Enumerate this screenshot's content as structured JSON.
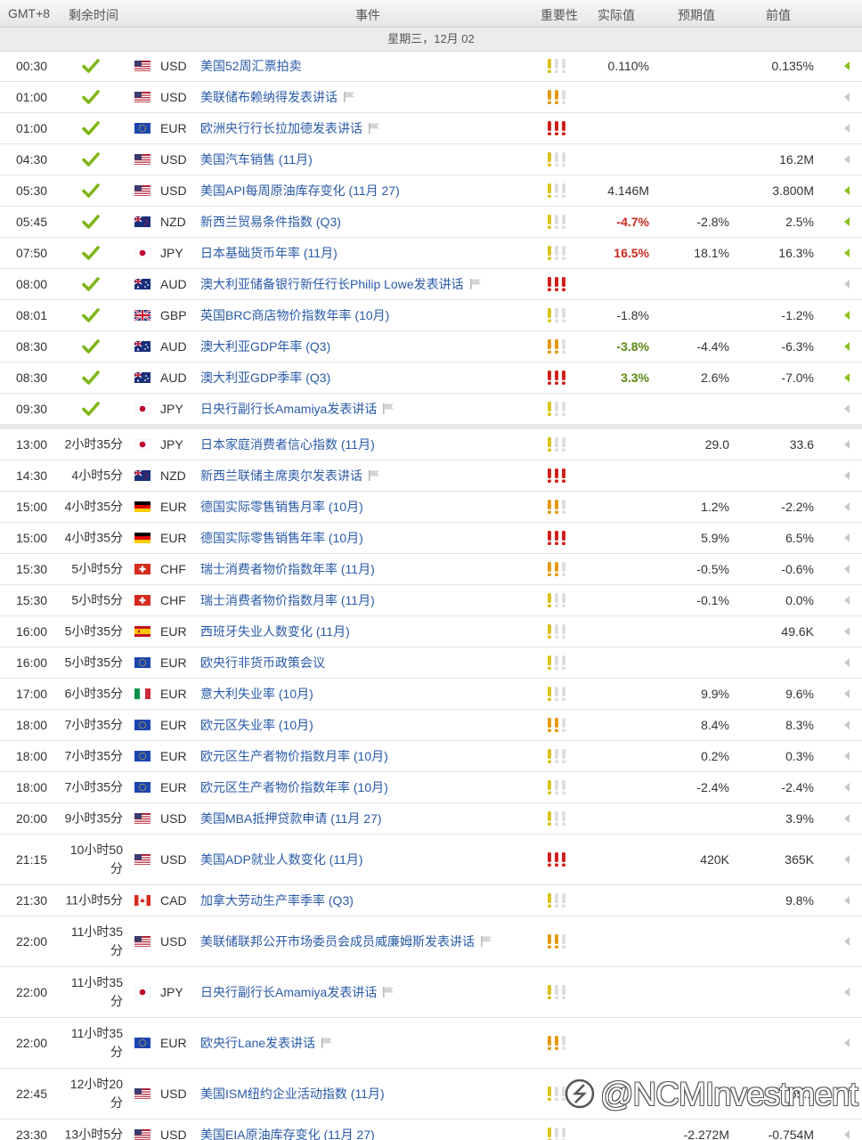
{
  "header": {
    "timezone": "GMT+8",
    "remaining": "剩余时间",
    "event": "事件",
    "importance": "重要性",
    "actual": "实际值",
    "forecast": "预期值",
    "previous": "前值"
  },
  "day_header": "星期三，12月 02",
  "colors": {
    "link": "#2a5aa8",
    "red": "#cc2a1e",
    "green": "#5b8a12",
    "check": "#7fb518",
    "imp_on_1": "#d9c21a",
    "imp_on_2": "#e69a12",
    "imp_on_3": "#d0201a",
    "imp_off": "#dedede"
  },
  "rows": [
    {
      "time": "00:30",
      "remaining": "",
      "done": true,
      "flag": "us",
      "currency": "USD",
      "event": "美国52周汇票拍卖",
      "speech": false,
      "importance": 1,
      "actual": "0.110%",
      "actual_style": "",
      "forecast": "",
      "previous": "0.135%",
      "arrow": "on"
    },
    {
      "time": "01:00",
      "remaining": "",
      "done": true,
      "flag": "us",
      "currency": "USD",
      "event": "美联储布赖纳得发表讲话",
      "speech": true,
      "importance": 2,
      "actual": "",
      "actual_style": "",
      "forecast": "",
      "previous": "",
      "arrow": ""
    },
    {
      "time": "01:00",
      "remaining": "",
      "done": true,
      "flag": "eu",
      "currency": "EUR",
      "event": "欧洲央行行长拉加德发表讲话",
      "speech": true,
      "importance": 3,
      "actual": "",
      "actual_style": "",
      "forecast": "",
      "previous": "",
      "arrow": ""
    },
    {
      "time": "04:30",
      "remaining": "",
      "done": true,
      "flag": "us",
      "currency": "USD",
      "event": "美国汽车销售 (11月)",
      "speech": false,
      "importance": 1,
      "actual": "",
      "actual_style": "",
      "forecast": "",
      "previous": "16.2M",
      "arrow": ""
    },
    {
      "time": "05:30",
      "remaining": "",
      "done": true,
      "flag": "us",
      "currency": "USD",
      "event": "美国API每周原油库存变化 (11月 27)",
      "speech": false,
      "importance": 1,
      "actual": "4.146M",
      "actual_style": "",
      "forecast": "",
      "previous": "3.800M",
      "arrow": "on"
    },
    {
      "time": "05:45",
      "remaining": "",
      "done": true,
      "flag": "nz",
      "currency": "NZD",
      "event": "新西兰贸易条件指数 (Q3)",
      "speech": false,
      "importance": 1,
      "actual": "-4.7%",
      "actual_style": "red",
      "forecast": "-2.8%",
      "previous": "2.5%",
      "arrow": "on"
    },
    {
      "time": "07:50",
      "remaining": "",
      "done": true,
      "flag": "jp",
      "currency": "JPY",
      "event": "日本基础货币年率 (11月)",
      "speech": false,
      "importance": 1,
      "actual": "16.5%",
      "actual_style": "red",
      "forecast": "18.1%",
      "previous": "16.3%",
      "arrow": "on"
    },
    {
      "time": "08:00",
      "remaining": "",
      "done": true,
      "flag": "au",
      "currency": "AUD",
      "event": "澳大利亚储备银行新任行长Philip Lowe发表讲话",
      "speech": true,
      "importance": 3,
      "actual": "",
      "actual_style": "",
      "forecast": "",
      "previous": "",
      "arrow": ""
    },
    {
      "time": "08:01",
      "remaining": "",
      "done": true,
      "flag": "gb",
      "currency": "GBP",
      "event": "英国BRC商店物价指数年率 (10月)",
      "speech": false,
      "importance": 1,
      "actual": "-1.8%",
      "actual_style": "",
      "forecast": "",
      "previous": "-1.2%",
      "arrow": "on"
    },
    {
      "time": "08:30",
      "remaining": "",
      "done": true,
      "flag": "au",
      "currency": "AUD",
      "event": "澳大利亚GDP年率 (Q3)",
      "speech": false,
      "importance": 2,
      "actual": "-3.8%",
      "actual_style": "green",
      "forecast": "-4.4%",
      "previous": "-6.3%",
      "arrow": "on"
    },
    {
      "time": "08:30",
      "remaining": "",
      "done": true,
      "flag": "au",
      "currency": "AUD",
      "event": "澳大利亚GDP季率 (Q3)",
      "speech": false,
      "importance": 3,
      "actual": "3.3%",
      "actual_style": "green",
      "forecast": "2.6%",
      "previous": "-7.0%",
      "arrow": "on"
    },
    {
      "time": "09:30",
      "remaining": "",
      "done": true,
      "flag": "jp",
      "currency": "JPY",
      "event": "日央行副行长Amamiya发表讲话",
      "speech": true,
      "importance": 1,
      "actual": "",
      "actual_style": "",
      "forecast": "",
      "previous": "",
      "arrow": "",
      "sep": true
    },
    {
      "time": "13:00",
      "remaining": "2小时35分",
      "done": false,
      "flag": "jp",
      "currency": "JPY",
      "event": "日本家庭消费者信心指数 (11月)",
      "speech": false,
      "importance": 1,
      "actual": "",
      "actual_style": "",
      "forecast": "29.0",
      "previous": "33.6",
      "arrow": ""
    },
    {
      "time": "14:30",
      "remaining": "4小时5分",
      "done": false,
      "flag": "nz",
      "currency": "NZD",
      "event": "新西兰联储主席奥尔发表讲话",
      "speech": true,
      "importance": 3,
      "actual": "",
      "actual_style": "",
      "forecast": "",
      "previous": "",
      "arrow": ""
    },
    {
      "time": "15:00",
      "remaining": "4小时35分",
      "done": false,
      "flag": "de",
      "currency": "EUR",
      "event": "德国实际零售销售月率 (10月)",
      "speech": false,
      "importance": 2,
      "actual": "",
      "actual_style": "",
      "forecast": "1.2%",
      "previous": "-2.2%",
      "arrow": ""
    },
    {
      "time": "15:00",
      "remaining": "4小时35分",
      "done": false,
      "flag": "de",
      "currency": "EUR",
      "event": "德国实际零售销售年率 (10月)",
      "speech": false,
      "importance": 3,
      "actual": "",
      "actual_style": "",
      "forecast": "5.9%",
      "previous": "6.5%",
      "arrow": ""
    },
    {
      "time": "15:30",
      "remaining": "5小时5分",
      "done": false,
      "flag": "ch",
      "currency": "CHF",
      "event": "瑞士消费者物价指数年率 (11月)",
      "speech": false,
      "importance": 2,
      "actual": "",
      "actual_style": "",
      "forecast": "-0.5%",
      "previous": "-0.6%",
      "arrow": ""
    },
    {
      "time": "15:30",
      "remaining": "5小时5分",
      "done": false,
      "flag": "ch",
      "currency": "CHF",
      "event": "瑞士消费者物价指数月率 (11月)",
      "speech": false,
      "importance": 1,
      "actual": "",
      "actual_style": "",
      "forecast": "-0.1%",
      "previous": "0.0%",
      "arrow": ""
    },
    {
      "time": "16:00",
      "remaining": "5小时35分",
      "done": false,
      "flag": "es",
      "currency": "EUR",
      "event": "西班牙失业人数变化 (11月)",
      "speech": false,
      "importance": 1,
      "actual": "",
      "actual_style": "",
      "forecast": "",
      "previous": "49.6K",
      "arrow": ""
    },
    {
      "time": "16:00",
      "remaining": "5小时35分",
      "done": false,
      "flag": "eu",
      "currency": "EUR",
      "event": "欧央行非货币政策会议",
      "speech": false,
      "importance": 1,
      "actual": "",
      "actual_style": "",
      "forecast": "",
      "previous": "",
      "arrow": ""
    },
    {
      "time": "17:00",
      "remaining": "6小时35分",
      "done": false,
      "flag": "it",
      "currency": "EUR",
      "event": "意大利失业率 (10月)",
      "speech": false,
      "importance": 1,
      "actual": "",
      "actual_style": "",
      "forecast": "9.9%",
      "previous": "9.6%",
      "arrow": ""
    },
    {
      "time": "18:00",
      "remaining": "7小时35分",
      "done": false,
      "flag": "eu",
      "currency": "EUR",
      "event": "欧元区失业率 (10月)",
      "speech": false,
      "importance": 2,
      "actual": "",
      "actual_style": "",
      "forecast": "8.4%",
      "previous": "8.3%",
      "arrow": ""
    },
    {
      "time": "18:00",
      "remaining": "7小时35分",
      "done": false,
      "flag": "eu",
      "currency": "EUR",
      "event": "欧元区生产者物价指数月率 (10月)",
      "speech": false,
      "importance": 1,
      "actual": "",
      "actual_style": "",
      "forecast": "0.2%",
      "previous": "0.3%",
      "arrow": ""
    },
    {
      "time": "18:00",
      "remaining": "7小时35分",
      "done": false,
      "flag": "eu",
      "currency": "EUR",
      "event": "欧元区生产者物价指数年率 (10月)",
      "speech": false,
      "importance": 1,
      "actual": "",
      "actual_style": "",
      "forecast": "-2.4%",
      "previous": "-2.4%",
      "arrow": ""
    },
    {
      "time": "20:00",
      "remaining": "9小时35分",
      "done": false,
      "flag": "us",
      "currency": "USD",
      "event": "美国MBA抵押贷款申请 (11月 27)",
      "speech": false,
      "importance": 1,
      "actual": "",
      "actual_style": "",
      "forecast": "",
      "previous": "3.9%",
      "arrow": ""
    },
    {
      "time": "21:15",
      "remaining": "10小时50分",
      "done": false,
      "flag": "us",
      "currency": "USD",
      "event": "美国ADP就业人数变化 (11月)",
      "speech": false,
      "importance": 3,
      "actual": "",
      "actual_style": "",
      "forecast": "420K",
      "previous": "365K",
      "arrow": "",
      "tall": true
    },
    {
      "time": "21:30",
      "remaining": "11小时5分",
      "done": false,
      "flag": "ca",
      "currency": "CAD",
      "event": "加拿大劳动生产率季率 (Q3)",
      "speech": false,
      "importance": 1,
      "actual": "",
      "actual_style": "",
      "forecast": "",
      "previous": "9.8%",
      "arrow": ""
    },
    {
      "time": "22:00",
      "remaining": "11小时35分",
      "done": false,
      "flag": "us",
      "currency": "USD",
      "event": "美联储联邦公开市场委员会成员威廉姆斯发表讲话",
      "speech": true,
      "importance": 2,
      "actual": "",
      "actual_style": "",
      "forecast": "",
      "previous": "",
      "arrow": "",
      "tall": true
    },
    {
      "time": "22:00",
      "remaining": "11小时35分",
      "done": false,
      "flag": "jp",
      "currency": "JPY",
      "event": "日央行副行长Amamiya发表讲话",
      "speech": true,
      "importance": 1,
      "actual": "",
      "actual_style": "",
      "forecast": "",
      "previous": "",
      "arrow": "",
      "tall": true
    },
    {
      "time": "22:00",
      "remaining": "11小时35分",
      "done": false,
      "flag": "eu",
      "currency": "EUR",
      "event": "欧央行Lane发表讲话",
      "speech": true,
      "importance": 2,
      "actual": "",
      "actual_style": "",
      "forecast": "",
      "previous": "",
      "arrow": "",
      "tall": true
    },
    {
      "time": "22:45",
      "remaining": "12小时20分",
      "done": false,
      "flag": "us",
      "currency": "USD",
      "event": "美国ISM纽约企业活动指数 (11月)",
      "speech": false,
      "importance": 1,
      "actual": "",
      "actual_style": "",
      "forecast": "",
      "previous": "65.1",
      "arrow": "",
      "tall": true
    },
    {
      "time": "23:30",
      "remaining": "13小时5分",
      "done": false,
      "flag": "us",
      "currency": "USD",
      "event": "美国EIA原油库存变化 (11月 27)",
      "speech": false,
      "importance": 1,
      "actual": "",
      "actual_style": "",
      "forecast": "-2.272M",
      "previous": "-0.754M",
      "arrow": ""
    }
  ],
  "watermark": "@NCMInvestment"
}
